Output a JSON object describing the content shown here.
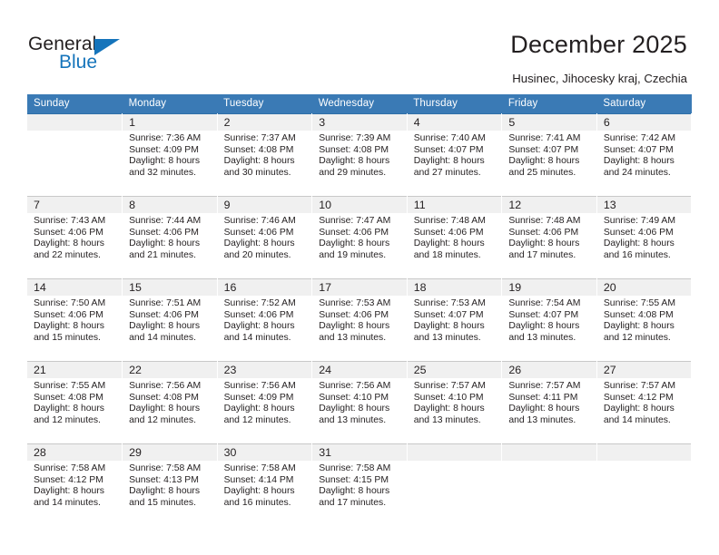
{
  "brand": {
    "word_one": "General",
    "word_two": "Blue",
    "accent_color": "#1574bb",
    "triangle_icon": "brand-triangle-icon"
  },
  "header": {
    "title": "December 2025",
    "subtitle": "Husinec, Jihocesky kraj, Czechia"
  },
  "theme": {
    "header_row_background": "#3a7ab5",
    "header_row_text": "#ffffff",
    "daynum_background": "#f0f0f0",
    "cell_background": "#ffffff",
    "grid_line": "#c8c8c8",
    "text": "#231f20"
  },
  "calendar": {
    "weekday_headers": [
      "Sunday",
      "Monday",
      "Tuesday",
      "Wednesday",
      "Thursday",
      "Friday",
      "Saturday"
    ],
    "weeks": [
      [
        {
          "day": "",
          "lines": []
        },
        {
          "day": "1",
          "lines": [
            "Sunrise: 7:36 AM",
            "Sunset: 4:09 PM",
            "Daylight: 8 hours",
            "and 32 minutes."
          ]
        },
        {
          "day": "2",
          "lines": [
            "Sunrise: 7:37 AM",
            "Sunset: 4:08 PM",
            "Daylight: 8 hours",
            "and 30 minutes."
          ]
        },
        {
          "day": "3",
          "lines": [
            "Sunrise: 7:39 AM",
            "Sunset: 4:08 PM",
            "Daylight: 8 hours",
            "and 29 minutes."
          ]
        },
        {
          "day": "4",
          "lines": [
            "Sunrise: 7:40 AM",
            "Sunset: 4:07 PM",
            "Daylight: 8 hours",
            "and 27 minutes."
          ]
        },
        {
          "day": "5",
          "lines": [
            "Sunrise: 7:41 AM",
            "Sunset: 4:07 PM",
            "Daylight: 8 hours",
            "and 25 minutes."
          ]
        },
        {
          "day": "6",
          "lines": [
            "Sunrise: 7:42 AM",
            "Sunset: 4:07 PM",
            "Daylight: 8 hours",
            "and 24 minutes."
          ]
        }
      ],
      [
        {
          "day": "7",
          "lines": [
            "Sunrise: 7:43 AM",
            "Sunset: 4:06 PM",
            "Daylight: 8 hours",
            "and 22 minutes."
          ]
        },
        {
          "day": "8",
          "lines": [
            "Sunrise: 7:44 AM",
            "Sunset: 4:06 PM",
            "Daylight: 8 hours",
            "and 21 minutes."
          ]
        },
        {
          "day": "9",
          "lines": [
            "Sunrise: 7:46 AM",
            "Sunset: 4:06 PM",
            "Daylight: 8 hours",
            "and 20 minutes."
          ]
        },
        {
          "day": "10",
          "lines": [
            "Sunrise: 7:47 AM",
            "Sunset: 4:06 PM",
            "Daylight: 8 hours",
            "and 19 minutes."
          ]
        },
        {
          "day": "11",
          "lines": [
            "Sunrise: 7:48 AM",
            "Sunset: 4:06 PM",
            "Daylight: 8 hours",
            "and 18 minutes."
          ]
        },
        {
          "day": "12",
          "lines": [
            "Sunrise: 7:48 AM",
            "Sunset: 4:06 PM",
            "Daylight: 8 hours",
            "and 17 minutes."
          ]
        },
        {
          "day": "13",
          "lines": [
            "Sunrise: 7:49 AM",
            "Sunset: 4:06 PM",
            "Daylight: 8 hours",
            "and 16 minutes."
          ]
        }
      ],
      [
        {
          "day": "14",
          "lines": [
            "Sunrise: 7:50 AM",
            "Sunset: 4:06 PM",
            "Daylight: 8 hours",
            "and 15 minutes."
          ]
        },
        {
          "day": "15",
          "lines": [
            "Sunrise: 7:51 AM",
            "Sunset: 4:06 PM",
            "Daylight: 8 hours",
            "and 14 minutes."
          ]
        },
        {
          "day": "16",
          "lines": [
            "Sunrise: 7:52 AM",
            "Sunset: 4:06 PM",
            "Daylight: 8 hours",
            "and 14 minutes."
          ]
        },
        {
          "day": "17",
          "lines": [
            "Sunrise: 7:53 AM",
            "Sunset: 4:06 PM",
            "Daylight: 8 hours",
            "and 13 minutes."
          ]
        },
        {
          "day": "18",
          "lines": [
            "Sunrise: 7:53 AM",
            "Sunset: 4:07 PM",
            "Daylight: 8 hours",
            "and 13 minutes."
          ]
        },
        {
          "day": "19",
          "lines": [
            "Sunrise: 7:54 AM",
            "Sunset: 4:07 PM",
            "Daylight: 8 hours",
            "and 13 minutes."
          ]
        },
        {
          "day": "20",
          "lines": [
            "Sunrise: 7:55 AM",
            "Sunset: 4:08 PM",
            "Daylight: 8 hours",
            "and 12 minutes."
          ]
        }
      ],
      [
        {
          "day": "21",
          "lines": [
            "Sunrise: 7:55 AM",
            "Sunset: 4:08 PM",
            "Daylight: 8 hours",
            "and 12 minutes."
          ]
        },
        {
          "day": "22",
          "lines": [
            "Sunrise: 7:56 AM",
            "Sunset: 4:08 PM",
            "Daylight: 8 hours",
            "and 12 minutes."
          ]
        },
        {
          "day": "23",
          "lines": [
            "Sunrise: 7:56 AM",
            "Sunset: 4:09 PM",
            "Daylight: 8 hours",
            "and 12 minutes."
          ]
        },
        {
          "day": "24",
          "lines": [
            "Sunrise: 7:56 AM",
            "Sunset: 4:10 PM",
            "Daylight: 8 hours",
            "and 13 minutes."
          ]
        },
        {
          "day": "25",
          "lines": [
            "Sunrise: 7:57 AM",
            "Sunset: 4:10 PM",
            "Daylight: 8 hours",
            "and 13 minutes."
          ]
        },
        {
          "day": "26",
          "lines": [
            "Sunrise: 7:57 AM",
            "Sunset: 4:11 PM",
            "Daylight: 8 hours",
            "and 13 minutes."
          ]
        },
        {
          "day": "27",
          "lines": [
            "Sunrise: 7:57 AM",
            "Sunset: 4:12 PM",
            "Daylight: 8 hours",
            "and 14 minutes."
          ]
        }
      ],
      [
        {
          "day": "28",
          "lines": [
            "Sunrise: 7:58 AM",
            "Sunset: 4:12 PM",
            "Daylight: 8 hours",
            "and 14 minutes."
          ]
        },
        {
          "day": "29",
          "lines": [
            "Sunrise: 7:58 AM",
            "Sunset: 4:13 PM",
            "Daylight: 8 hours",
            "and 15 minutes."
          ]
        },
        {
          "day": "30",
          "lines": [
            "Sunrise: 7:58 AM",
            "Sunset: 4:14 PM",
            "Daylight: 8 hours",
            "and 16 minutes."
          ]
        },
        {
          "day": "31",
          "lines": [
            "Sunrise: 7:58 AM",
            "Sunset: 4:15 PM",
            "Daylight: 8 hours",
            "and 17 minutes."
          ]
        },
        {
          "day": "",
          "lines": []
        },
        {
          "day": "",
          "lines": []
        },
        {
          "day": "",
          "lines": []
        }
      ]
    ]
  }
}
